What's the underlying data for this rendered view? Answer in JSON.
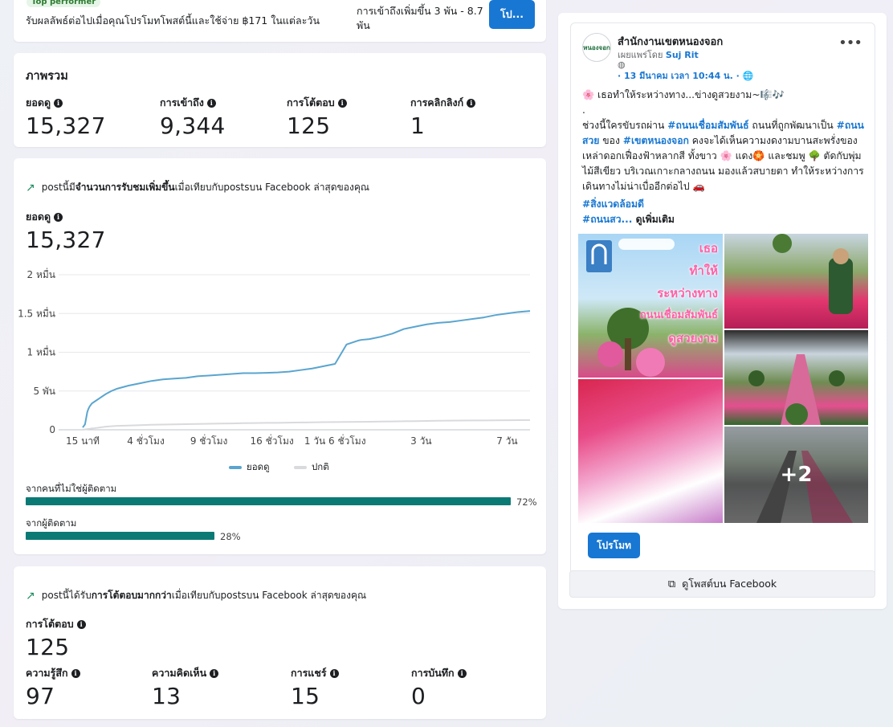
{
  "promo": {
    "badge": "Top performer",
    "text": "รับผลลัพธ์ต่อไปเมื่อคุณโปรโมทโพสต์นี้และใช้จ่าย ฿171 ในแต่ละวัน",
    "reach": "การเข้าถึงเพิ่มขึ้น 3 พัน - 8.7 พัน",
    "button": "โป..."
  },
  "overview": {
    "title": "ภาพรวม",
    "metrics": [
      {
        "label": "ยอดดู",
        "value": "15,327"
      },
      {
        "label": "การเข้าถึง",
        "value": "9,344"
      },
      {
        "label": "การโต้ตอบ",
        "value": "125"
      },
      {
        "label": "การคลิกลิงก์",
        "value": "1"
      }
    ]
  },
  "views_card": {
    "insight_pre": "postนี้มี",
    "insight_bold": "จำนวนการรับชมเพิ่มขึ้น",
    "insight_post": "เมื่อเทียบกับpostsบน Facebook ล่าสุดของคุณ",
    "metric_label": "ยอดดู",
    "metric_value": "15,327",
    "legend": {
      "views": "ยอดดู",
      "normal": "ปกติ"
    },
    "breakdown": [
      {
        "label": "จากคนที่ไม่ใช่ผู้ติดตาม",
        "percent": 72,
        "percent_text": "72%"
      },
      {
        "label": "จากผู้ติดตาม",
        "percent": 28,
        "percent_text": "28%"
      }
    ],
    "colors": {
      "views": "#5aa5cf",
      "normal": "#d9dadd",
      "bar": "#0b7a75"
    }
  },
  "chart_data": {
    "type": "line",
    "x": [
      0,
      0.1,
      0.2,
      0.3,
      0.4,
      0.5,
      0.6,
      0.7,
      0.8,
      1,
      1.5,
      2,
      2.5,
      3,
      4,
      5,
      6,
      7,
      8,
      9,
      10,
      11,
      12,
      13,
      14,
      15,
      16,
      17,
      18,
      19,
      20,
      21,
      22,
      23,
      24,
      24.3,
      25,
      26,
      27,
      28,
      29,
      30,
      31,
      32,
      33,
      34,
      35,
      36,
      37,
      38,
      39
    ],
    "x_ticks": [
      "15 นาที",
      "4 ชั่วโมง",
      "9 ชั่วโมง",
      "16 ชั่วโมง",
      "1 วัน 6 ชั่วโมง",
      "3 วัน",
      "7 วัน"
    ],
    "x_tick_positions": [
      0,
      5.5,
      11,
      16.5,
      22,
      29.5,
      37
    ],
    "series": [
      {
        "name": "ยอดดู",
        "values": [
          300,
          500,
          700,
          1500,
          2300,
          2700,
          3000,
          3200,
          3400,
          3600,
          4100,
          4600,
          5000,
          5300,
          5700,
          6000,
          6300,
          6500,
          6600,
          6700,
          6900,
          7000,
          7100,
          7200,
          7300,
          7300,
          7350,
          7400,
          7500,
          7700,
          7900,
          8200,
          8500,
          11000,
          11500,
          11600,
          11700,
          12000,
          12400,
          13000,
          13300,
          13600,
          13800,
          13900,
          14100,
          14300,
          14500,
          14800,
          15000,
          15200,
          15327
        ]
      },
      {
        "name": "ปกติ",
        "values": [
          0,
          20,
          40,
          60,
          80,
          100,
          120,
          150,
          180,
          200,
          300,
          400,
          450,
          500,
          550,
          600,
          650,
          680,
          700,
          720,
          750,
          780,
          800,
          820,
          850,
          870,
          890,
          900,
          920,
          940,
          960,
          980,
          1000,
          1010,
          1020,
          1025,
          1040,
          1060,
          1080,
          1100,
          1120,
          1140,
          1160,
          1180,
          1190,
          1200,
          1210,
          1220,
          1230,
          1240,
          1250
        ]
      }
    ],
    "y_ticks": [
      "2 หมื่น",
      "1.5 หมื่น",
      "1 หมื่น",
      "5 พัน",
      "0"
    ],
    "ylim": [
      0,
      20000
    ],
    "grid": true,
    "legend_position": "bottom"
  },
  "reactions_card": {
    "insight_pre": "postนี้ได้รับ",
    "insight_bold": "การโต้ตอบมากกว่า",
    "insight_post": "เมื่อเทียบกับpostsบน Facebook ล่าสุดของคุณ",
    "metric_label": "การโต้ตอบ",
    "metric_value": "125",
    "metrics": [
      {
        "label": "ความรู้สึก",
        "value": "97"
      },
      {
        "label": "ความคิดเห็น",
        "value": "13"
      },
      {
        "label": "การแชร์",
        "value": "15"
      },
      {
        "label": "การบันทึก",
        "value": "0"
      }
    ]
  },
  "post": {
    "page_name": "สำนักงานเขตหนองจอก",
    "published_by_pre": "เผยแพร่โดย",
    "published_by_name": "Suj Rit",
    "timestamp": "· 13 มีนาคม เวลา 10:44 น. ·",
    "avatar_text": "หนองจอก",
    "line1": "🌸 เธอทำให้ระหว่างทาง...ข่างดูสวยงาม~🎼🎶",
    "line2": ".",
    "p1_a": "ช่วงนี้ใครขับรถผ่าน ",
    "p1_tag1": "#ถนนเชื่อมสัมพันธ์",
    "p1_b": " ถนนที่ถูกพัฒนาเป็น ",
    "p1_tag2": "#ถนนสวย",
    "p1_c": " ของ ",
    "p1_tag3": "#เขตหนองจอก",
    "p1_d": " คงจะได้เห็นความงดงามบานสะพรั่งของเหล่าดอกเฟื่องฟ้าหลากสี ทั้งขาว 🌸 แดง🏵️ และชมพู 🌳 ตัดกับพุ่มไม้สีเขียว บริเวณเกาะกลางถนน มองแล้วสบายตา ทำให้ระหว่างการเดินทางไม่น่าเบื่ออีกต่อไป 🚗",
    "tag4": "#สิ่งแวดล้อมดี",
    "tag5": "#ถนนสว...",
    "see_more": " ดูเพิ่มเติม",
    "image_text_lines": [
      "เธอ",
      "ทำให้",
      "ระหว่างทาง",
      "ถนนเชื่อมสัมพันธ์",
      "ดูสวยงาม"
    ],
    "more_images": "+2",
    "promote_button": "โปรโมท",
    "view_on_fb": "ดูโพสต์บน Facebook"
  }
}
